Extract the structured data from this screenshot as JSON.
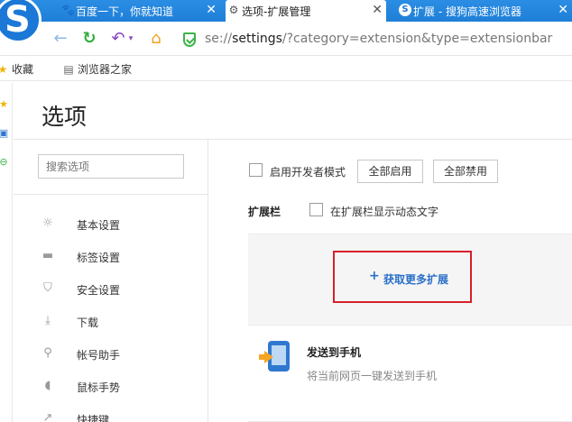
{
  "tabs": [
    {
      "title": "百度一下，你就知道",
      "icon": "paw-icon",
      "active": false
    },
    {
      "title": "选项-扩展管理",
      "icon": "gear-icon",
      "active": true
    },
    {
      "title": "扩展 - 搜狗高速浏览器",
      "icon": "sogou-icon",
      "active": false
    }
  ],
  "tab_close_glyph": "✕",
  "address": {
    "prefix": "se://",
    "host": "settings",
    "rest": "/?category=extension&type=extensionbar"
  },
  "bookmarks": [
    {
      "label": "收藏",
      "icon": "star-icon",
      "glyph": "★"
    },
    {
      "label": "浏览器之家",
      "icon": "page-icon",
      "glyph": "▤"
    }
  ],
  "page": {
    "title": "选项",
    "search_placeholder": "搜索选项",
    "nav": [
      {
        "label": "基本设置",
        "icon": "gear-icon",
        "glyph": "☼"
      },
      {
        "label": "标签设置",
        "icon": "tab-icon",
        "glyph": "▬"
      },
      {
        "label": "安全设置",
        "icon": "shield-icon",
        "glyph": "⛉"
      },
      {
        "label": "下载",
        "icon": "download-icon",
        "glyph": "⤓"
      },
      {
        "label": "帐号助手",
        "icon": "key-icon",
        "glyph": "⚲"
      },
      {
        "label": "鼠标手势",
        "icon": "mouse-icon",
        "glyph": "◖"
      },
      {
        "label": "快捷键",
        "icon": "shortcut-icon",
        "glyph": "↗"
      }
    ],
    "dev_mode_label": "启用开发者模式",
    "enable_all": "全部启用",
    "disable_all": "全部禁用",
    "extbar_label": "扩展栏",
    "dynamic_text_label": "在扩展栏显示动态文字",
    "get_more": "获取更多扩展",
    "get_more_plus": "+",
    "extension": {
      "name": "发送到手机",
      "desc": "将当前网页一键发送到手机"
    }
  },
  "colors": {
    "accent": "#2a6fc9",
    "highlight_border": "#d6202a",
    "tabbar": "#2b8de3"
  }
}
